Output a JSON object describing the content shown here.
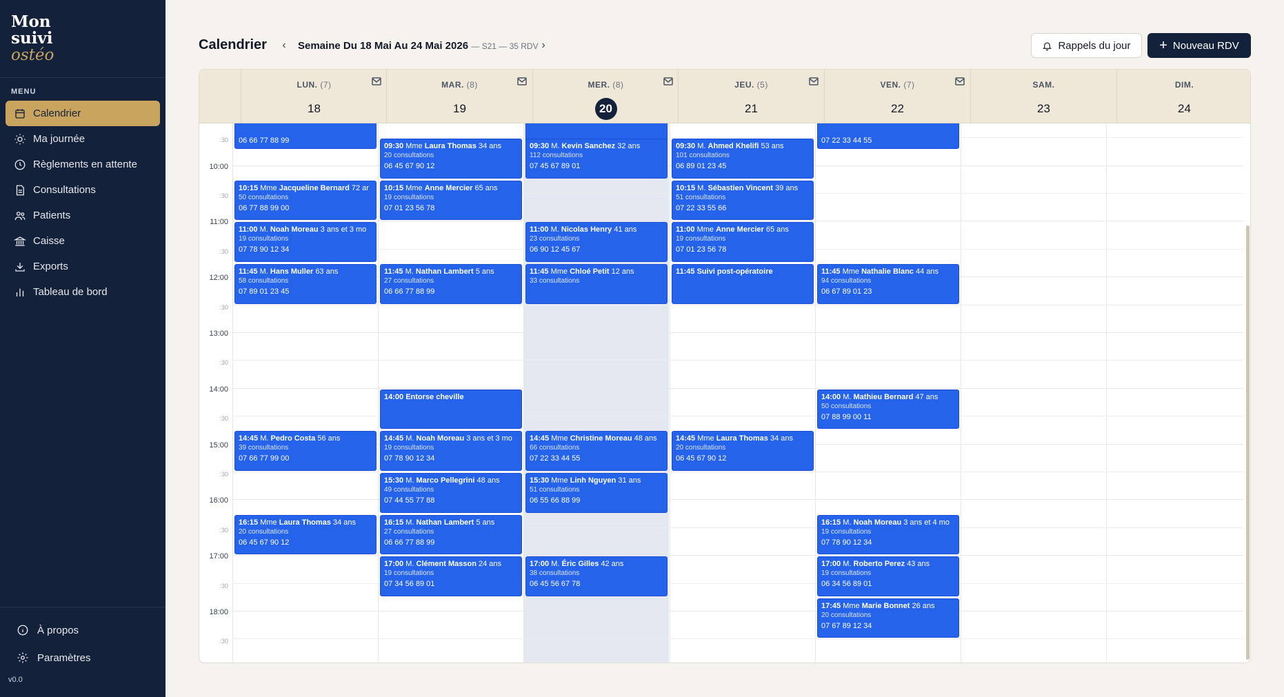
{
  "brand": {
    "line1": "Mon",
    "line2": "suivi",
    "line3": "ostéo"
  },
  "sidebar": {
    "menu_title": "MENU",
    "items": [
      {
        "label": "Calendrier",
        "icon": "calendar-icon",
        "active": true
      },
      {
        "label": "Ma journée",
        "icon": "sun-icon",
        "active": false
      },
      {
        "label": "Règlements en attente",
        "icon": "clock-icon",
        "active": false
      },
      {
        "label": "Consultations",
        "icon": "document-icon",
        "active": false
      },
      {
        "label": "Patients",
        "icon": "users-icon",
        "active": false
      },
      {
        "label": "Caisse",
        "icon": "bank-icon",
        "active": false
      },
      {
        "label": "Exports",
        "icon": "download-icon",
        "active": false
      },
      {
        "label": "Tableau de bord",
        "icon": "bar-chart-icon",
        "active": false
      }
    ],
    "bottom": [
      {
        "label": "À propos",
        "icon": "info-icon"
      },
      {
        "label": "Paramètres",
        "icon": "gear-icon"
      }
    ],
    "version": "v0.0"
  },
  "header": {
    "title": "Calendrier",
    "week_label": "Semaine Du 18 Mai Au 24 Mai 2026",
    "week_meta": "— S21 — 35 RDV",
    "reminders_button": "Rappels du jour",
    "new_button": "Nouveau RDV"
  },
  "calendar": {
    "days": [
      {
        "name": "LUN.",
        "count": "(7)",
        "num": "18",
        "today": false,
        "mail": true
      },
      {
        "name": "MAR.",
        "count": "(8)",
        "num": "19",
        "today": false,
        "mail": true
      },
      {
        "name": "MER.",
        "count": "(8)",
        "num": "20",
        "today": true,
        "mail": true
      },
      {
        "name": "JEU.",
        "count": "(5)",
        "num": "21",
        "today": false,
        "mail": true
      },
      {
        "name": "VEN.",
        "count": "(7)",
        "num": "22",
        "today": false,
        "mail": true
      },
      {
        "name": "SAM.",
        "count": "",
        "num": "23",
        "today": false,
        "mail": false
      },
      {
        "name": "DIM.",
        "count": "",
        "num": "24",
        "today": false,
        "mail": false
      }
    ],
    "time_labels": [
      ":30",
      "10:00",
      ":30",
      "11:00",
      ":30",
      "12:00",
      ":30",
      "13:00",
      ":30",
      "14:00",
      ":30",
      "15:00",
      ":30",
      "16:00",
      ":30",
      "17:00",
      ":30",
      "18:00",
      ":30"
    ],
    "appointments": [
      {
        "day": 0,
        "start": 9.0,
        "time": "",
        "title": "",
        "rest": "",
        "consults": "",
        "phone": "06 66 77 88 99"
      },
      {
        "day": 2,
        "start": 9.0,
        "time": "",
        "title": "",
        "rest": "",
        "consults": "",
        "phone": ""
      },
      {
        "day": 4,
        "start": 9.0,
        "time": "",
        "title": "",
        "rest": "",
        "consults": "",
        "phone": "07 22 33 44 55"
      },
      {
        "day": 1,
        "start": 9.5,
        "time": "09:30",
        "title": "Mme",
        "name": "Laura Thomas",
        "rest": "34 ans",
        "consults": "20 consultations",
        "phone": "06 45 67 90 12"
      },
      {
        "day": 2,
        "start": 9.5,
        "time": "09:30",
        "title": "M.",
        "name": "Kevin Sanchez",
        "rest": "32 ans",
        "consults": "112 consultations",
        "phone": "07 45 67 89 01"
      },
      {
        "day": 3,
        "start": 9.5,
        "time": "09:30",
        "title": "M.",
        "name": "Ahmed Khelifi",
        "rest": "53 ans",
        "consults": "101 consultations",
        "phone": "06 89 01 23 45"
      },
      {
        "day": 0,
        "start": 10.25,
        "time": "10:15",
        "title": "Mme",
        "name": "Jacqueline Bernard",
        "rest": "72 ar",
        "consults": "50 consultations",
        "phone": "06 77 88 99 00"
      },
      {
        "day": 1,
        "start": 10.25,
        "time": "10:15",
        "title": "Mme",
        "name": "Anne Mercier",
        "rest": "65 ans",
        "consults": "19 consultations",
        "phone": "07 01 23 56 78"
      },
      {
        "day": 3,
        "start": 10.25,
        "time": "10:15",
        "title": "M.",
        "name": "Sébastien Vincent",
        "rest": "39 ans",
        "consults": "51 consultations",
        "phone": "07 22 33 55 66"
      },
      {
        "day": 0,
        "start": 11.0,
        "time": "11:00",
        "title": "M.",
        "name": "Noah Moreau",
        "rest": "3 ans et 3 mo",
        "consults": "19 consultations",
        "phone": "07 78 90 12 34"
      },
      {
        "day": 2,
        "start": 11.0,
        "time": "11:00",
        "title": "M.",
        "name": "Nicolas Henry",
        "rest": "41 ans",
        "consults": "23 consultations",
        "phone": "06 90 12 45 67"
      },
      {
        "day": 3,
        "start": 11.0,
        "time": "11:00",
        "title": "Mme",
        "name": "Anne Mercier",
        "rest": "65 ans",
        "consults": "19 consultations",
        "phone": "07 01 23 56 78"
      },
      {
        "day": 0,
        "start": 11.75,
        "time": "11:45",
        "title": "M.",
        "name": "Hans Muller",
        "rest": "63 ans",
        "consults": "58 consultations",
        "phone": "07 89 01 23 45"
      },
      {
        "day": 1,
        "start": 11.75,
        "time": "11:45",
        "title": "M.",
        "name": "Nathan Lambert",
        "rest": "5 ans",
        "consults": "27 consultations",
        "phone": "06 66 77 88 99"
      },
      {
        "day": 2,
        "start": 11.75,
        "time": "11:45",
        "title": "Mme",
        "name": "Chloé Petit",
        "rest": "12 ans",
        "consults": "33 consultations",
        "phone": ""
      },
      {
        "day": 3,
        "start": 11.75,
        "time": "11:45",
        "title": "",
        "name": "Suivi post-opératoire",
        "rest": "",
        "consults": "",
        "phone": ""
      },
      {
        "day": 4,
        "start": 11.75,
        "time": "11:45",
        "title": "Mme",
        "name": "Nathalie Blanc",
        "rest": "44 ans",
        "consults": "94 consultations",
        "phone": "06 67 89 01 23"
      },
      {
        "day": 1,
        "start": 14.0,
        "time": "14:00",
        "title": "",
        "name": "Entorse cheville",
        "rest": "",
        "consults": "",
        "phone": ""
      },
      {
        "day": 4,
        "start": 14.0,
        "time": "14:00",
        "title": "M.",
        "name": "Mathieu Bernard",
        "rest": "47 ans",
        "consults": "50 consultations",
        "phone": "07 88 99 00 11"
      },
      {
        "day": 0,
        "start": 14.75,
        "time": "14:45",
        "title": "M.",
        "name": "Pedro Costa",
        "rest": "56 ans",
        "consults": "39 consultations",
        "phone": "07 66 77 99 00"
      },
      {
        "day": 1,
        "start": 14.75,
        "time": "14:45",
        "title": "M.",
        "name": "Noah Moreau",
        "rest": "3 ans et 3 mo",
        "consults": "19 consultations",
        "phone": "07 78 90 12 34"
      },
      {
        "day": 2,
        "start": 14.75,
        "time": "14:45",
        "title": "Mme",
        "name": "Christine Moreau",
        "rest": "48 ans",
        "consults": "66 consultations",
        "phone": "07 22 33 44 55"
      },
      {
        "day": 3,
        "start": 14.75,
        "time": "14:45",
        "title": "Mme",
        "name": "Laura Thomas",
        "rest": "34 ans",
        "consults": "20 consultations",
        "phone": "06 45 67 90 12"
      },
      {
        "day": 1,
        "start": 15.5,
        "time": "15:30",
        "title": "M.",
        "name": "Marco Pellegrini",
        "rest": "48 ans",
        "consults": "49 consultations",
        "phone": "07 44 55 77 88"
      },
      {
        "day": 2,
        "start": 15.5,
        "time": "15:30",
        "title": "Mme",
        "name": "Linh Nguyen",
        "rest": "31 ans",
        "consults": "51 consultations",
        "phone": "06 55 66 88 99"
      },
      {
        "day": 0,
        "start": 16.25,
        "time": "16:15",
        "title": "Mme",
        "name": "Laura Thomas",
        "rest": "34 ans",
        "consults": "20 consultations",
        "phone": "06 45 67 90 12"
      },
      {
        "day": 1,
        "start": 16.25,
        "time": "16:15",
        "title": "M.",
        "name": "Nathan Lambert",
        "rest": "5 ans",
        "consults": "27 consultations",
        "phone": "06 66 77 88 99"
      },
      {
        "day": 4,
        "start": 16.25,
        "time": "16:15",
        "title": "M.",
        "name": "Noah Moreau",
        "rest": "3 ans et 4 mo",
        "consults": "19 consultations",
        "phone": "07 78 90 12 34"
      },
      {
        "day": 1,
        "start": 17.0,
        "time": "17:00",
        "title": "M.",
        "name": "Clément Masson",
        "rest": "24 ans",
        "consults": "19 consultations",
        "phone": "07 34 56 89 01"
      },
      {
        "day": 2,
        "start": 17.0,
        "time": "17:00",
        "title": "M.",
        "name": "Éric Gilles",
        "rest": "42 ans",
        "consults": "38 consultations",
        "phone": "06 45 56 67 78"
      },
      {
        "day": 4,
        "start": 17.0,
        "time": "17:00",
        "title": "M.",
        "name": "Roberto Perez",
        "rest": "43 ans",
        "consults": "19 consultations",
        "phone": "06 34 56 89 01"
      },
      {
        "day": 4,
        "start": 17.75,
        "time": "17:45",
        "title": "Mme",
        "name": "Marie Bonnet",
        "rest": "26 ans",
        "consults": "20 consultations",
        "phone": "07 67 89 12 34"
      }
    ]
  },
  "colors": {
    "sidebar_bg": "#14213a",
    "accent_gold": "#c9a45e",
    "appointment_blue": "#2563eb",
    "page_bg": "#f6f3ee",
    "today_column": "#e3e8f1"
  }
}
